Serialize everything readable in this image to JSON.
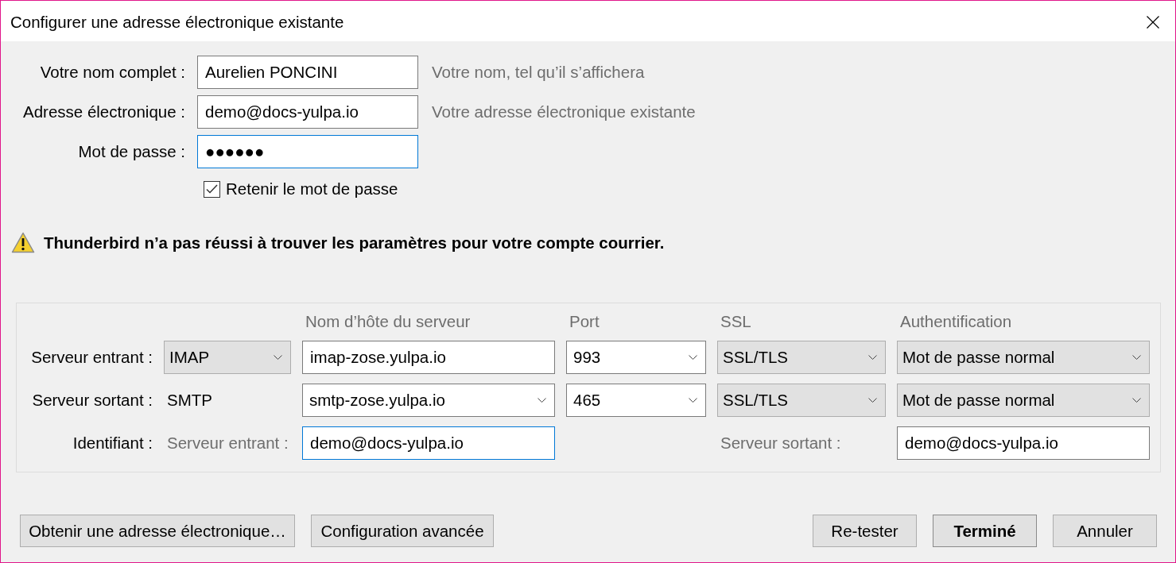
{
  "window": {
    "title": "Configurer une adresse électronique existante"
  },
  "identity": {
    "fields": [
      {
        "label": "Votre nom complet :",
        "value": "Aurelien PONCINI",
        "hint": "Votre nom, tel qu’il s’affichera",
        "focused": false
      },
      {
        "label": "Adresse électronique :",
        "value": "demo@docs-yulpa.io",
        "hint": "Votre adresse électronique existante",
        "focused": false
      },
      {
        "label": "Mot de passe :",
        "value": "●●●●●●",
        "focused": true
      }
    ],
    "remember_password": {
      "label": "Retenir le mot de passe",
      "checked": true
    }
  },
  "warning": {
    "text": "Thunderbird n’a pas réussi à trouver les paramètres pour votre compte courrier."
  },
  "server_settings": {
    "columns": [
      "Nom d’hôte du serveur",
      "Port",
      "SSL",
      "Authentification"
    ],
    "servers": [
      {
        "label": "Serveur entrant :",
        "protocol": {
          "kind": "select",
          "value": "IMAP"
        },
        "hostname": {
          "kind": "input",
          "value": "imap-zose.yulpa.io"
        },
        "port": {
          "kind": "combo",
          "value": "993"
        },
        "ssl": {
          "kind": "select",
          "value": "SSL/TLS"
        },
        "authentication": {
          "kind": "select",
          "value": "Mot de passe normal"
        }
      },
      {
        "label": "Serveur sortant :",
        "protocol": {
          "kind": "text",
          "value": "SMTP"
        },
        "hostname": {
          "kind": "combo",
          "value": "smtp-zose.yulpa.io"
        },
        "port": {
          "kind": "combo",
          "value": "465"
        },
        "ssl": {
          "kind": "select",
          "value": "SSL/TLS"
        },
        "authentication": {
          "kind": "select",
          "value": "Mot de passe normal"
        }
      }
    ],
    "username": {
      "label": "Identifiant :",
      "incoming": {
        "label": "Serveur entrant :",
        "value": "demo@docs-yulpa.io",
        "focused": true
      },
      "outgoing": {
        "label": "Serveur sortant :",
        "value": "demo@docs-yulpa.io",
        "focused": false
      }
    }
  },
  "footer": {
    "left_buttons": [
      {
        "label": "Obtenir une adresse électronique…",
        "default": false
      },
      {
        "label": "Configuration avancée",
        "default": false
      }
    ],
    "right_buttons": [
      {
        "label": "Re-tester",
        "default": false
      },
      {
        "label": "Terminé",
        "default": true
      },
      {
        "label": "Annuler",
        "default": false
      }
    ]
  }
}
